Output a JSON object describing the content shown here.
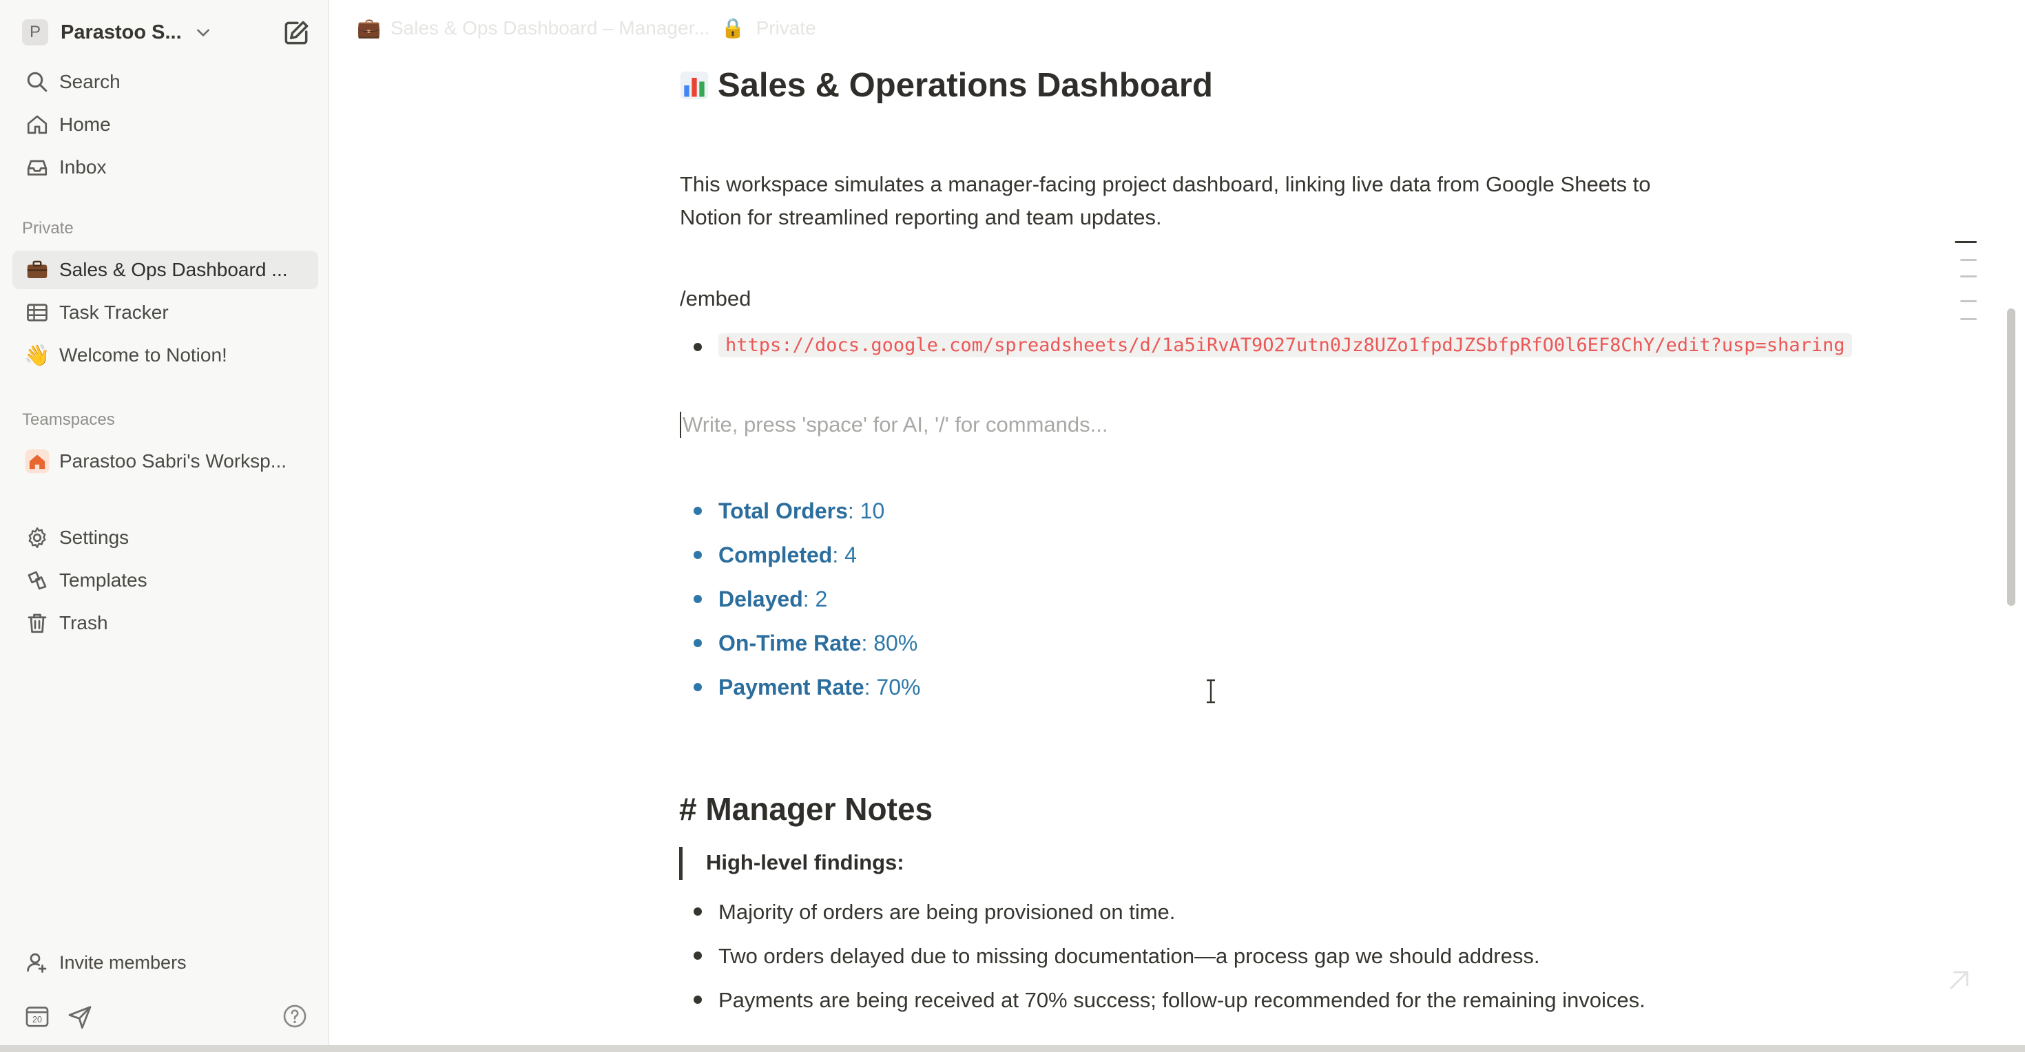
{
  "sidebar": {
    "workspace_initial": "P",
    "workspace_name": "Parastoo S...",
    "nav": [
      {
        "label": "Search",
        "icon": "search-icon"
      },
      {
        "label": "Home",
        "icon": "home-icon"
      },
      {
        "label": "Inbox",
        "icon": "inbox-icon"
      }
    ],
    "private_label": "Private",
    "private_items": [
      {
        "label": "Sales & Ops Dashboard ...",
        "icon": "briefcase-icon",
        "active": true
      },
      {
        "label": "Task Tracker",
        "icon": "table-icon"
      },
      {
        "label": "Welcome to Notion!",
        "icon": "wave-icon"
      }
    ],
    "teamspaces_label": "Teamspaces",
    "teamspace_items": [
      {
        "label": "Parastoo Sabri's Worksp...",
        "icon": "house-icon"
      }
    ],
    "utility_items": [
      {
        "label": "Settings",
        "icon": "gear-icon"
      },
      {
        "label": "Templates",
        "icon": "templates-icon"
      },
      {
        "label": "Trash",
        "icon": "trash-icon"
      }
    ],
    "invite_label": "Invite members",
    "calendar_day": "20"
  },
  "topbar": {
    "breadcrumb_title": "Sales & Ops Dashboard – Manager...",
    "breadcrumb_status": "Private"
  },
  "page": {
    "title": "Sales & Operations Dashboard",
    "intro": "This workspace simulates a manager-facing project dashboard, linking live data from Google Sheets to Notion for streamlined reporting and team updates.",
    "command": "/embed",
    "embed_url": "https://docs.google.com/spreadsheets/d/1a5iRvAT9O27utn0Jz8UZo1fpdJZSbfpRfO0l6EF8ChY/edit?usp=sharing",
    "placeholder": "Write, press 'space' for AI, '/' for commands...",
    "metrics": [
      {
        "label": "Total Orders",
        "value": ": 10"
      },
      {
        "label": "Completed",
        "value": ": 4"
      },
      {
        "label": "Delayed",
        "value": ": 2"
      },
      {
        "label": "On-Time Rate",
        "value": ": 80%"
      },
      {
        "label": "Payment Rate",
        "value": ": 70%"
      }
    ],
    "notes_heading": "# Manager Notes",
    "findings_label": "High-level findings:",
    "findings": [
      "Majority of orders are being provisioned on time.",
      "Two orders delayed due to missing documentation—a process gap we should address.",
      "Payments are being received at 70% success; follow-up recommended for the remaining invoices."
    ]
  },
  "colors": {
    "metric_blue": "#2e78a9",
    "code_red": "#eb5757",
    "sidebar_bg": "#f8f8f7"
  }
}
